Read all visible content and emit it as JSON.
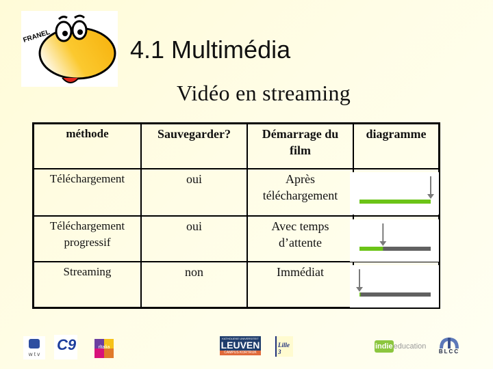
{
  "slide": {
    "title": "4.1 Multimédia",
    "subtitle": "Vidéo en streaming",
    "mascot_label": "FRANEL"
  },
  "table": {
    "headers": [
      "méthode",
      "Sauvegarder?",
      "Démarrage du film",
      "diagramme"
    ],
    "rows": [
      {
        "method": "Téléchargement",
        "save": "oui",
        "start": "Après téléchargement",
        "downloaded_fraction": 1.0,
        "playback_start_fraction": 1.0
      },
      {
        "method": "Téléchargement progressif",
        "save": "oui",
        "start": "Avec temps d’attente",
        "downloaded_fraction": 0.33,
        "playback_start_fraction": 0.33
      },
      {
        "method": "Streaming",
        "save": "non",
        "start": "Immédiat",
        "downloaded_fraction": 0.01,
        "playback_start_fraction": 0.0
      }
    ],
    "colors": {
      "downloaded": "#6cc417",
      "remaining": "#616161",
      "arrow": "#7a7a7a"
    }
  },
  "footer_logos": [
    {
      "name": "wtv",
      "text": "w t v"
    },
    {
      "name": "c9",
      "text": "C9"
    },
    {
      "name": "ritalia",
      "text": "rltalia"
    },
    {
      "name": "leuven",
      "text_top": "KATHOLIEKE UNIVERSITEIT",
      "text_main": "LEUVEN",
      "text_bottom": "CAMPUS KORTRIJK"
    },
    {
      "name": "lille3",
      "text": "Lille 3"
    },
    {
      "name": "indieeducation",
      "text_box": "indie",
      "text_rest": "education"
    },
    {
      "name": "blcc",
      "text": "BLCC"
    }
  ]
}
